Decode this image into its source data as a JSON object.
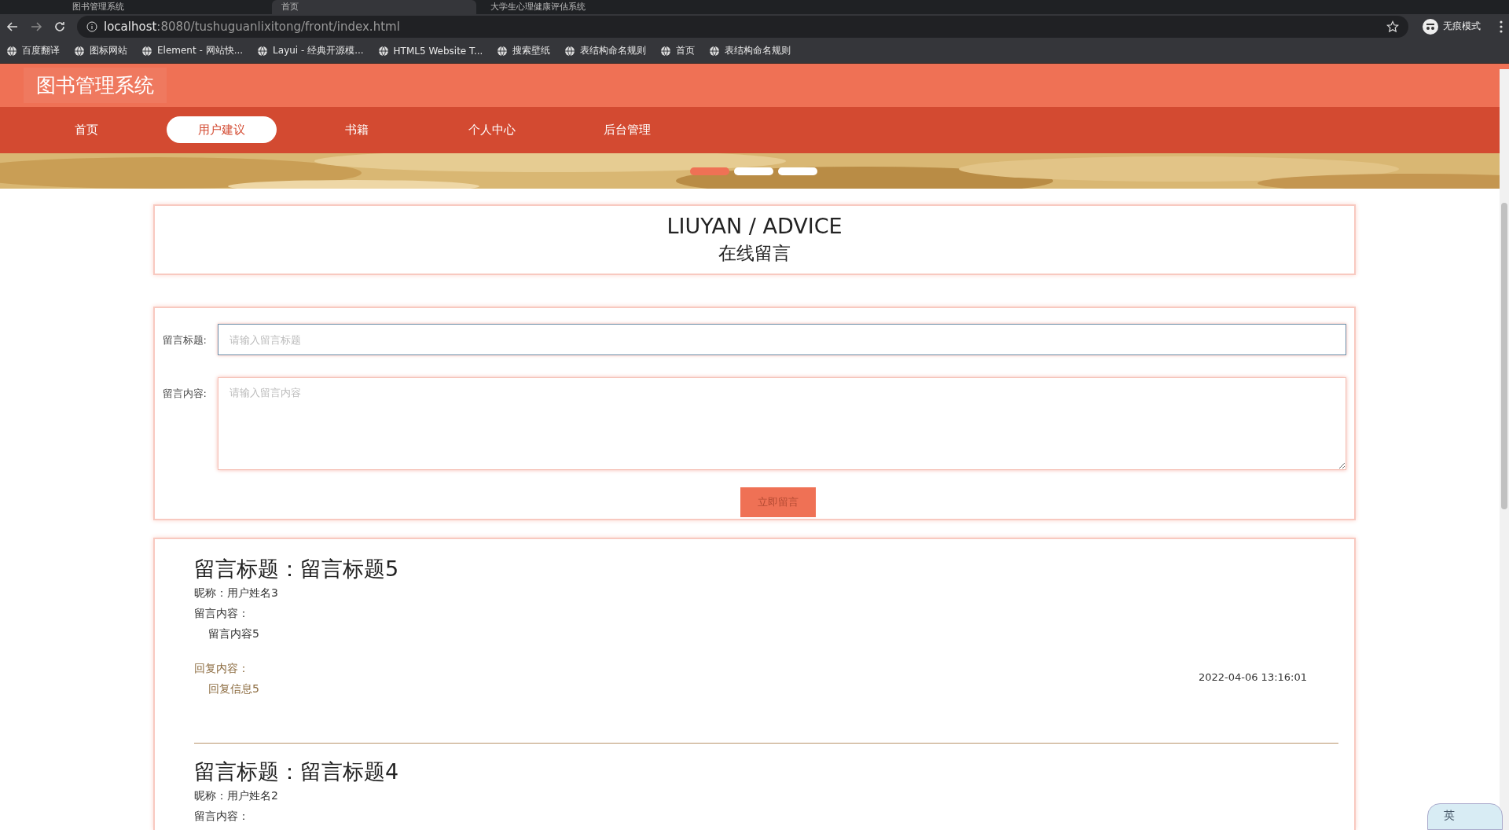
{
  "browser": {
    "tabs": [
      {
        "title": "图书管理系统",
        "selected": false
      },
      {
        "title": "首页",
        "selected": true
      },
      {
        "title": "大学生心理健康评估系统",
        "selected": false
      }
    ],
    "url_host": "localhost",
    "url_rest": ":8080/tushuguanlixitong/front/index.html",
    "profile": "无痕模式",
    "bookmarks": [
      {
        "label": "百度翻译"
      },
      {
        "label": "图标网站"
      },
      {
        "label": "Element - 网站快..."
      },
      {
        "label": "Layui - 经典开源模..."
      },
      {
        "label": "HTML5 Website T..."
      },
      {
        "label": "搜索壁纸"
      },
      {
        "label": "表结构命名规则"
      },
      {
        "label": "首页"
      },
      {
        "label": "表结构命名规则"
      }
    ]
  },
  "site": {
    "title": "图书管理系统",
    "nav": [
      {
        "label": "首页",
        "selected": false
      },
      {
        "label": "用户建议",
        "selected": true
      },
      {
        "label": "书籍",
        "selected": false
      },
      {
        "label": "个人中心",
        "selected": false
      },
      {
        "label": "后台管理",
        "selected": false
      }
    ],
    "carousel_dots": [
      {
        "selected": true
      },
      {
        "selected": false
      },
      {
        "selected": false
      }
    ]
  },
  "heading": {
    "title": "LIUYAN / ADVICE",
    "subtitle": "在线留言"
  },
  "form": {
    "title_label": "留言标题:",
    "title_placeholder": "请输入留言标题",
    "content_label": "留言内容:",
    "content_placeholder": "请输入留言内容",
    "submit": "立即留言"
  },
  "messages": [
    {
      "title": "留言标题：留言标题5",
      "nickname": "昵称：用户姓名3",
      "content_label": "留言内容：",
      "content": "留言内容5",
      "reply_label": "回复内容：",
      "reply": "回复信息5",
      "time": "2022-04-06 13:16:01"
    },
    {
      "title": "留言标题：留言标题4",
      "nickname": "昵称：用户姓名2",
      "content_label": "留言内容："
    }
  ],
  "ime": "英"
}
